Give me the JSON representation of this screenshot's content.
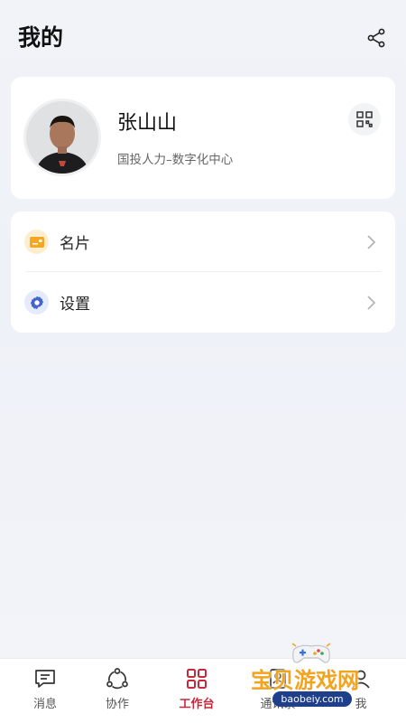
{
  "header": {
    "title": "我的"
  },
  "profile": {
    "name": "张山山",
    "org": "国投人力–数字化中心"
  },
  "menu": [
    {
      "label": "名片",
      "icon": "business-card-icon"
    },
    {
      "label": "设置",
      "icon": "gear-icon"
    }
  ],
  "tabs": [
    {
      "label": "消息",
      "icon": "message-icon",
      "active": false
    },
    {
      "label": "协作",
      "icon": "collaborate-icon",
      "active": false
    },
    {
      "label": "工作台",
      "icon": "grid-icon",
      "active": true
    },
    {
      "label": "通讯录",
      "icon": "contacts-icon",
      "active": false
    },
    {
      "label": "我",
      "icon": "me-icon",
      "active": false
    }
  ],
  "watermark": {
    "text": "宝贝游戏网",
    "url": "baobeiy.com"
  },
  "colors": {
    "accent": "#c8283b",
    "card_icon": "#f5a623",
    "gear_icon": "#4466cc"
  }
}
